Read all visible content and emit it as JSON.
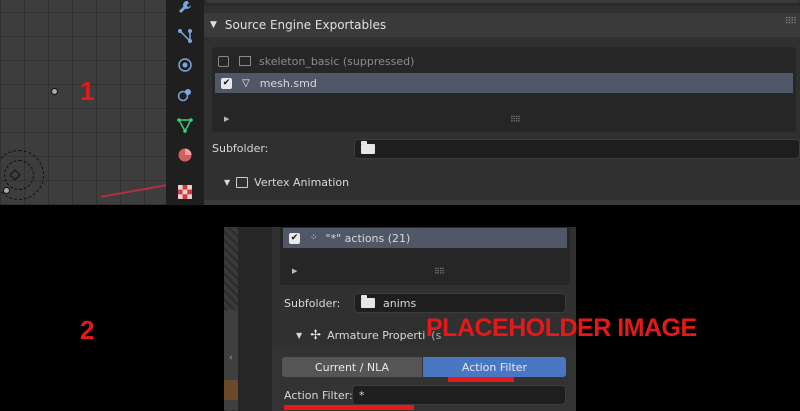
{
  "panel1": {
    "label": "1",
    "section_title": "Source Engine Exportables",
    "items": [
      {
        "name": "skeleton_basic (suppressed)",
        "checked": false,
        "selected": false,
        "icon": "armature-object-icon"
      },
      {
        "name": "mesh.smd",
        "checked": true,
        "selected": true,
        "icon": "mesh-triangle-icon"
      }
    ],
    "subfolder_label": "Subfolder:",
    "subfolder_value": "",
    "subsection_title": "Vertex Animation",
    "tabs": [
      "wrench-icon",
      "constraint-icon",
      "physics-icon",
      "particles-icon",
      "vertex-data-icon",
      "material-icon",
      "texture-icon"
    ]
  },
  "panel2": {
    "label": "2",
    "placeholder": "PLACEHOLDER IMAGE",
    "items": [
      {
        "name": "\"*\" actions (21)",
        "checked": true,
        "selected": true,
        "icon": "actions-icon"
      }
    ],
    "subfolder_label": "Subfolder:",
    "subfolder_value": "anims",
    "subsection_title": "Armature Properti",
    "subsection_overlap": "(s",
    "segments": [
      "Current / NLA",
      "Action Filter"
    ],
    "active_segment": "Action Filter",
    "action_filter_label": "Action Filter:",
    "action_filter_value": "*"
  },
  "colors": {
    "accent": "#4a77c4",
    "selected_row": "#505868",
    "annotation_red": "#e41a1a"
  }
}
